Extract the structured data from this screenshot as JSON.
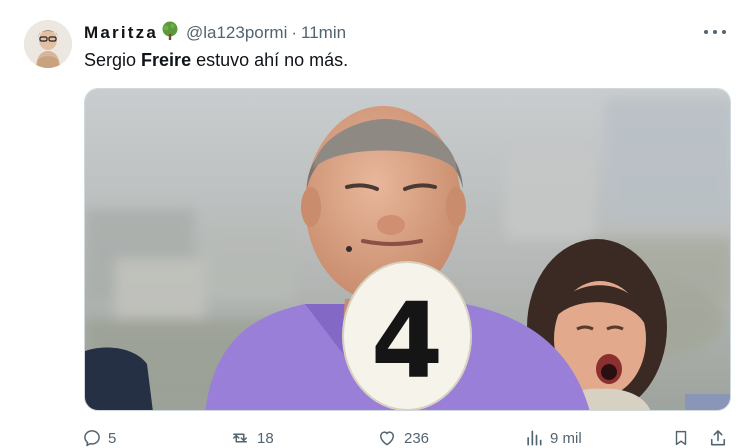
{
  "tweet": {
    "display_name": "Maritza",
    "handle": "@la123pormi",
    "separator": "·",
    "time": "11min",
    "text_before": "Sergio ",
    "text_bold": "Freire",
    "text_after": " estuvo ahí no más.",
    "media": {
      "paddle_number": "4"
    },
    "actions": {
      "replies": "5",
      "retweets": "18",
      "likes": "236",
      "views": "9 mil"
    }
  },
  "icons": {
    "name_emoji": "tree-emoji",
    "more": "more-icon",
    "reply": "reply-icon",
    "retweet": "retweet-icon",
    "like": "heart-icon",
    "views": "views-icon",
    "bookmark": "bookmark-icon",
    "share": "share-icon"
  },
  "colors": {
    "text_primary": "#0f1419",
    "text_secondary": "#536471",
    "shirt": "#9a7fd8"
  }
}
